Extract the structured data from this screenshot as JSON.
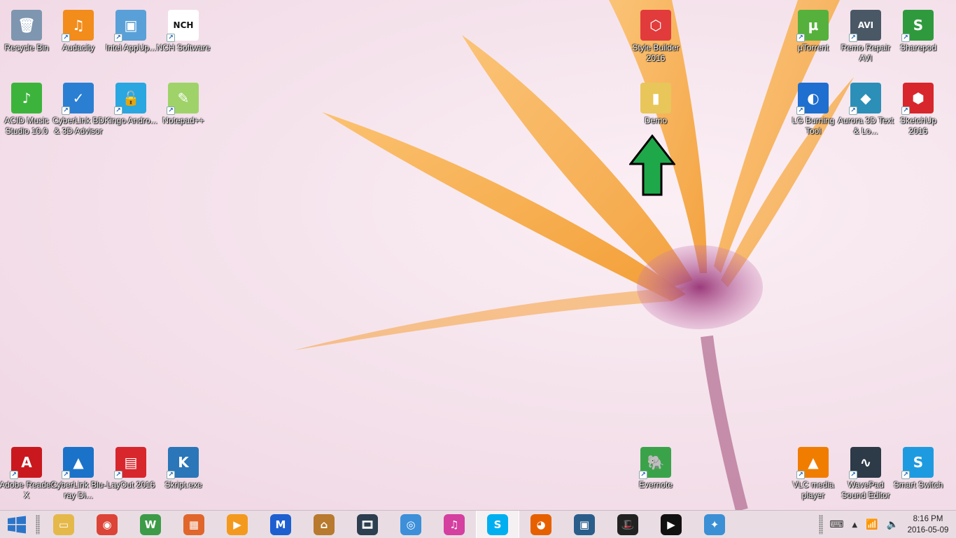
{
  "desktop_icons": [
    {
      "label": "Recycle Bin",
      "icon": "recycle-bin-icon",
      "color": "#7f96b0",
      "glyph": "🗑",
      "shortcut": false
    },
    {
      "label": "Audacity",
      "icon": "audacity-icon",
      "color": "#f28c1b",
      "glyph": "♫",
      "shortcut": true
    },
    {
      "label": "Intel AppUp...",
      "icon": "intel-appup-icon",
      "color": "#5aa0d8",
      "glyph": "▣",
      "shortcut": true
    },
    {
      "label": "NCH Software",
      "icon": "nch-software-icon",
      "color": "#ffffff",
      "glyph": "NCH",
      "shortcut": true
    },
    {
      "label": "ACID Music Studio 10.0",
      "icon": "acid-music-icon",
      "color": "#3cb43c",
      "glyph": "♪",
      "shortcut": false
    },
    {
      "label": "CyberLink BD & 3D Advisor",
      "icon": "cyberlink-advisor-icon",
      "color": "#2b7fd3",
      "glyph": "✓",
      "shortcut": true
    },
    {
      "label": "Kingo Andro...",
      "icon": "kingo-android-icon",
      "color": "#2aa6e0",
      "glyph": "🔓",
      "shortcut": true
    },
    {
      "label": "Notepad++",
      "icon": "notepad-plus-plus-icon",
      "color": "#9fd36a",
      "glyph": "✎",
      "shortcut": true
    },
    {
      "label": "Style Builder 2016",
      "icon": "style-builder-icon",
      "color": "#e23b3b",
      "glyph": "⬡",
      "shortcut": false
    },
    {
      "label": "Demo",
      "icon": "folder-icon",
      "color": "#e8c65a",
      "glyph": "▮",
      "shortcut": false
    },
    {
      "label": "µTorrent",
      "icon": "utorrent-icon",
      "color": "#56b13c",
      "glyph": "µ",
      "shortcut": true
    },
    {
      "label": "Remo Repair AVI",
      "icon": "remo-repair-avi-icon",
      "color": "#4a5866",
      "glyph": "AVI",
      "shortcut": true
    },
    {
      "label": "Sharepod",
      "icon": "sharepod-icon",
      "color": "#2f9a3d",
      "glyph": "S",
      "shortcut": true
    },
    {
      "label": "LG Burning Tool",
      "icon": "lg-burning-tool-icon",
      "color": "#1e6fd0",
      "glyph": "◐",
      "shortcut": true
    },
    {
      "label": "Aurora 3D Text & Lo...",
      "icon": "aurora-3d-icon",
      "color": "#2b8fb8",
      "glyph": "◆",
      "shortcut": true
    },
    {
      "label": "SketchUp 2016",
      "icon": "sketchup-icon",
      "color": "#d8262d",
      "glyph": "⬢",
      "shortcut": true
    },
    {
      "label": "Adobe Reader X",
      "icon": "adobe-reader-icon",
      "color": "#c9191e",
      "glyph": "A",
      "shortcut": true
    },
    {
      "label": "CyberLink Blu-ray Di...",
      "icon": "cyberlink-bluray-icon",
      "color": "#1b72c9",
      "glyph": "▲",
      "shortcut": true
    },
    {
      "label": "LayOut 2016",
      "icon": "layout-icon",
      "color": "#d8262d",
      "glyph": "▤",
      "shortcut": true
    },
    {
      "label": "Skript.exe",
      "icon": "skript-icon",
      "color": "#2a76b8",
      "glyph": "K",
      "shortcut": true
    },
    {
      "label": "Evernote",
      "icon": "evernote-icon",
      "color": "#3aa34a",
      "glyph": "🐘",
      "shortcut": true
    },
    {
      "label": "VLC media player",
      "icon": "vlc-icon",
      "color": "#f07d00",
      "glyph": "▲",
      "shortcut": true
    },
    {
      "label": "WavePad Sound Editor",
      "icon": "wavepad-icon",
      "color": "#2d3a48",
      "glyph": "∿",
      "shortcut": true
    },
    {
      "label": "Smart Switch",
      "icon": "smart-switch-icon",
      "color": "#1e9be0",
      "glyph": "S",
      "shortcut": true
    }
  ],
  "taskbar": {
    "start_icon": "windows-start-icon",
    "apps": [
      {
        "name": "file-explorer-icon",
        "color": "#e5b84a",
        "glyph": "▭"
      },
      {
        "name": "chrome-icon",
        "color": "#db4437",
        "glyph": "◉"
      },
      {
        "name": "wondershare-icon",
        "color": "#3d9b48",
        "glyph": "W"
      },
      {
        "name": "colorful-app-icon",
        "color": "#e0662c",
        "glyph": "▦"
      },
      {
        "name": "media-player-icon",
        "color": "#f39a1e",
        "glyph": "▶"
      },
      {
        "name": "malwarebytes-icon",
        "color": "#1e5fd0",
        "glyph": "M"
      },
      {
        "name": "temple-app-icon",
        "color": "#b87a2e",
        "glyph": "⌂"
      },
      {
        "name": "video-editor-icon",
        "color": "#2c3e50",
        "glyph": "🎞"
      },
      {
        "name": "chat-app-icon",
        "color": "#3c8fd8",
        "glyph": "◎"
      },
      {
        "name": "itunes-icon",
        "color": "#d43fa0",
        "glyph": "♫"
      },
      {
        "name": "skype-icon",
        "color": "#00aff0",
        "glyph": "S",
        "active": true
      },
      {
        "name": "firefox-icon",
        "color": "#e66000",
        "glyph": "◕"
      },
      {
        "name": "remote-desktop-icon",
        "color": "#2b5d8a",
        "glyph": "▣"
      },
      {
        "name": "hypercam-icon",
        "color": "#222222",
        "glyph": "🎩"
      },
      {
        "name": "video-player-icon",
        "color": "#111111",
        "glyph": "▶"
      },
      {
        "name": "safari-icon",
        "color": "#3b8fd4",
        "glyph": "✦"
      }
    ],
    "tray": {
      "keyboard_icon": "keyboard-icon",
      "chevron_icon": "chevron-up-icon",
      "signal_icon": "network-signal-icon",
      "volume_icon": "volume-icon",
      "time": "8:16 PM",
      "date": "2016-05-09"
    }
  },
  "annotation": {
    "arrow_color": "#1fa84a"
  }
}
